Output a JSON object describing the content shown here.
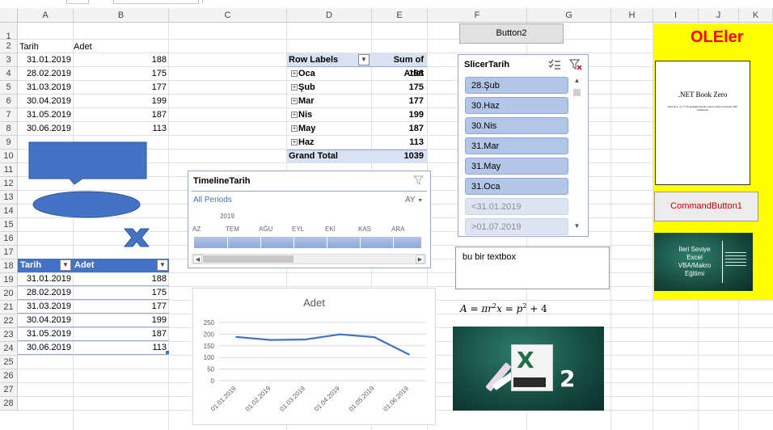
{
  "columns": [
    "A",
    "B",
    "C",
    "D",
    "E",
    "F",
    "G",
    "H",
    "I",
    "J",
    "K"
  ],
  "rows": [
    "1",
    "2",
    "3",
    "4",
    "5",
    "6",
    "7",
    "8",
    "9",
    "10",
    "11",
    "12",
    "13",
    "14",
    "15",
    "16",
    "17",
    "18",
    "19",
    "20",
    "21",
    "22",
    "23",
    "24",
    "25",
    "26",
    "27",
    "28"
  ],
  "headers": {
    "tarih": "Tarih",
    "adet": "Adet"
  },
  "data_rows": [
    {
      "tarih": "31.01.2019",
      "adet": "188"
    },
    {
      "tarih": "28.02.2019",
      "adet": "175"
    },
    {
      "tarih": "31.03.2019",
      "adet": "177"
    },
    {
      "tarih": "30.04.2019",
      "adet": "199"
    },
    {
      "tarih": "31.05.2019",
      "adet": "187"
    },
    {
      "tarih": "30.06.2019",
      "adet": "113"
    }
  ],
  "pivot": {
    "row_labels": "Row Labels",
    "sum_label": "Sum of Adet",
    "items": [
      {
        "label": "Oca",
        "value": "188"
      },
      {
        "label": "Şub",
        "value": "175"
      },
      {
        "label": "Mar",
        "value": "177"
      },
      {
        "label": "Nis",
        "value": "199"
      },
      {
        "label": "May",
        "value": "187"
      },
      {
        "label": "Haz",
        "value": "113"
      }
    ],
    "grand_total_label": "Grand Total",
    "grand_total_value": "1039"
  },
  "button2_label": "Button2",
  "slicer": {
    "title": "SlicerTarih",
    "items": [
      {
        "label": "28.Şub",
        "state": "selected"
      },
      {
        "label": "30.Haz",
        "state": "selected"
      },
      {
        "label": "30.Nis",
        "state": "selected"
      },
      {
        "label": "31.Mar",
        "state": "selected"
      },
      {
        "label": "31.May",
        "state": "selected"
      },
      {
        "label": "31.Oca",
        "state": "selected"
      },
      {
        "label": "<31.01.2019",
        "state": "nodata"
      },
      {
        "label": ">01.07.2019",
        "state": "nodata"
      }
    ]
  },
  "timeline": {
    "title": "TimelineTarih",
    "all_periods": "All Periods",
    "level": "AY",
    "year": "2019",
    "months": [
      "AZ",
      "TEM",
      "AĞU",
      "EYL",
      "EKİ",
      "KAS",
      "ARA"
    ]
  },
  "textbox_text": "bu bir textbox",
  "formula": {
    "a": "A",
    "eq": "=",
    "pi": "π",
    "r": "r",
    "sq": "2",
    "x": "x",
    "eq2": "=",
    "p": "p",
    "sq2": "2",
    "plus": "+",
    "four": "4"
  },
  "ole": {
    "title": "OLEler",
    "book_title": ".NET Book Zero",
    "book_subtitle": "What the C or C++ Programmer Needs to Know about C# and the .NET Framework",
    "command_button": "CommandButton1",
    "slide_lines": [
      "İleri Seviye",
      "Excel",
      "VBA/Makro",
      "Eğitimi"
    ]
  },
  "logo_number": "2",
  "chart_data": {
    "type": "line",
    "title": "Adet",
    "categories": [
      "01.01.2019",
      "01.02.2019",
      "01.03.2019",
      "01.04.2019",
      "01.05.2019",
      "01.06.2019"
    ],
    "series": [
      {
        "values": [
          188,
          175,
          177,
          199,
          187,
          113
        ]
      }
    ],
    "yticks": [
      "0",
      "50",
      "100",
      "150",
      "200",
      "250"
    ],
    "ylim": [
      0,
      250
    ],
    "grid": true,
    "line_color": "#4472c4"
  },
  "colors": {
    "accent": "#4472c4",
    "slicer_selected": "#b4c6e7",
    "pivot_header": "#d9e1f2",
    "ole_bg": "#ffff00",
    "ole_title": "#ff0000",
    "command_text": "#c00000"
  }
}
